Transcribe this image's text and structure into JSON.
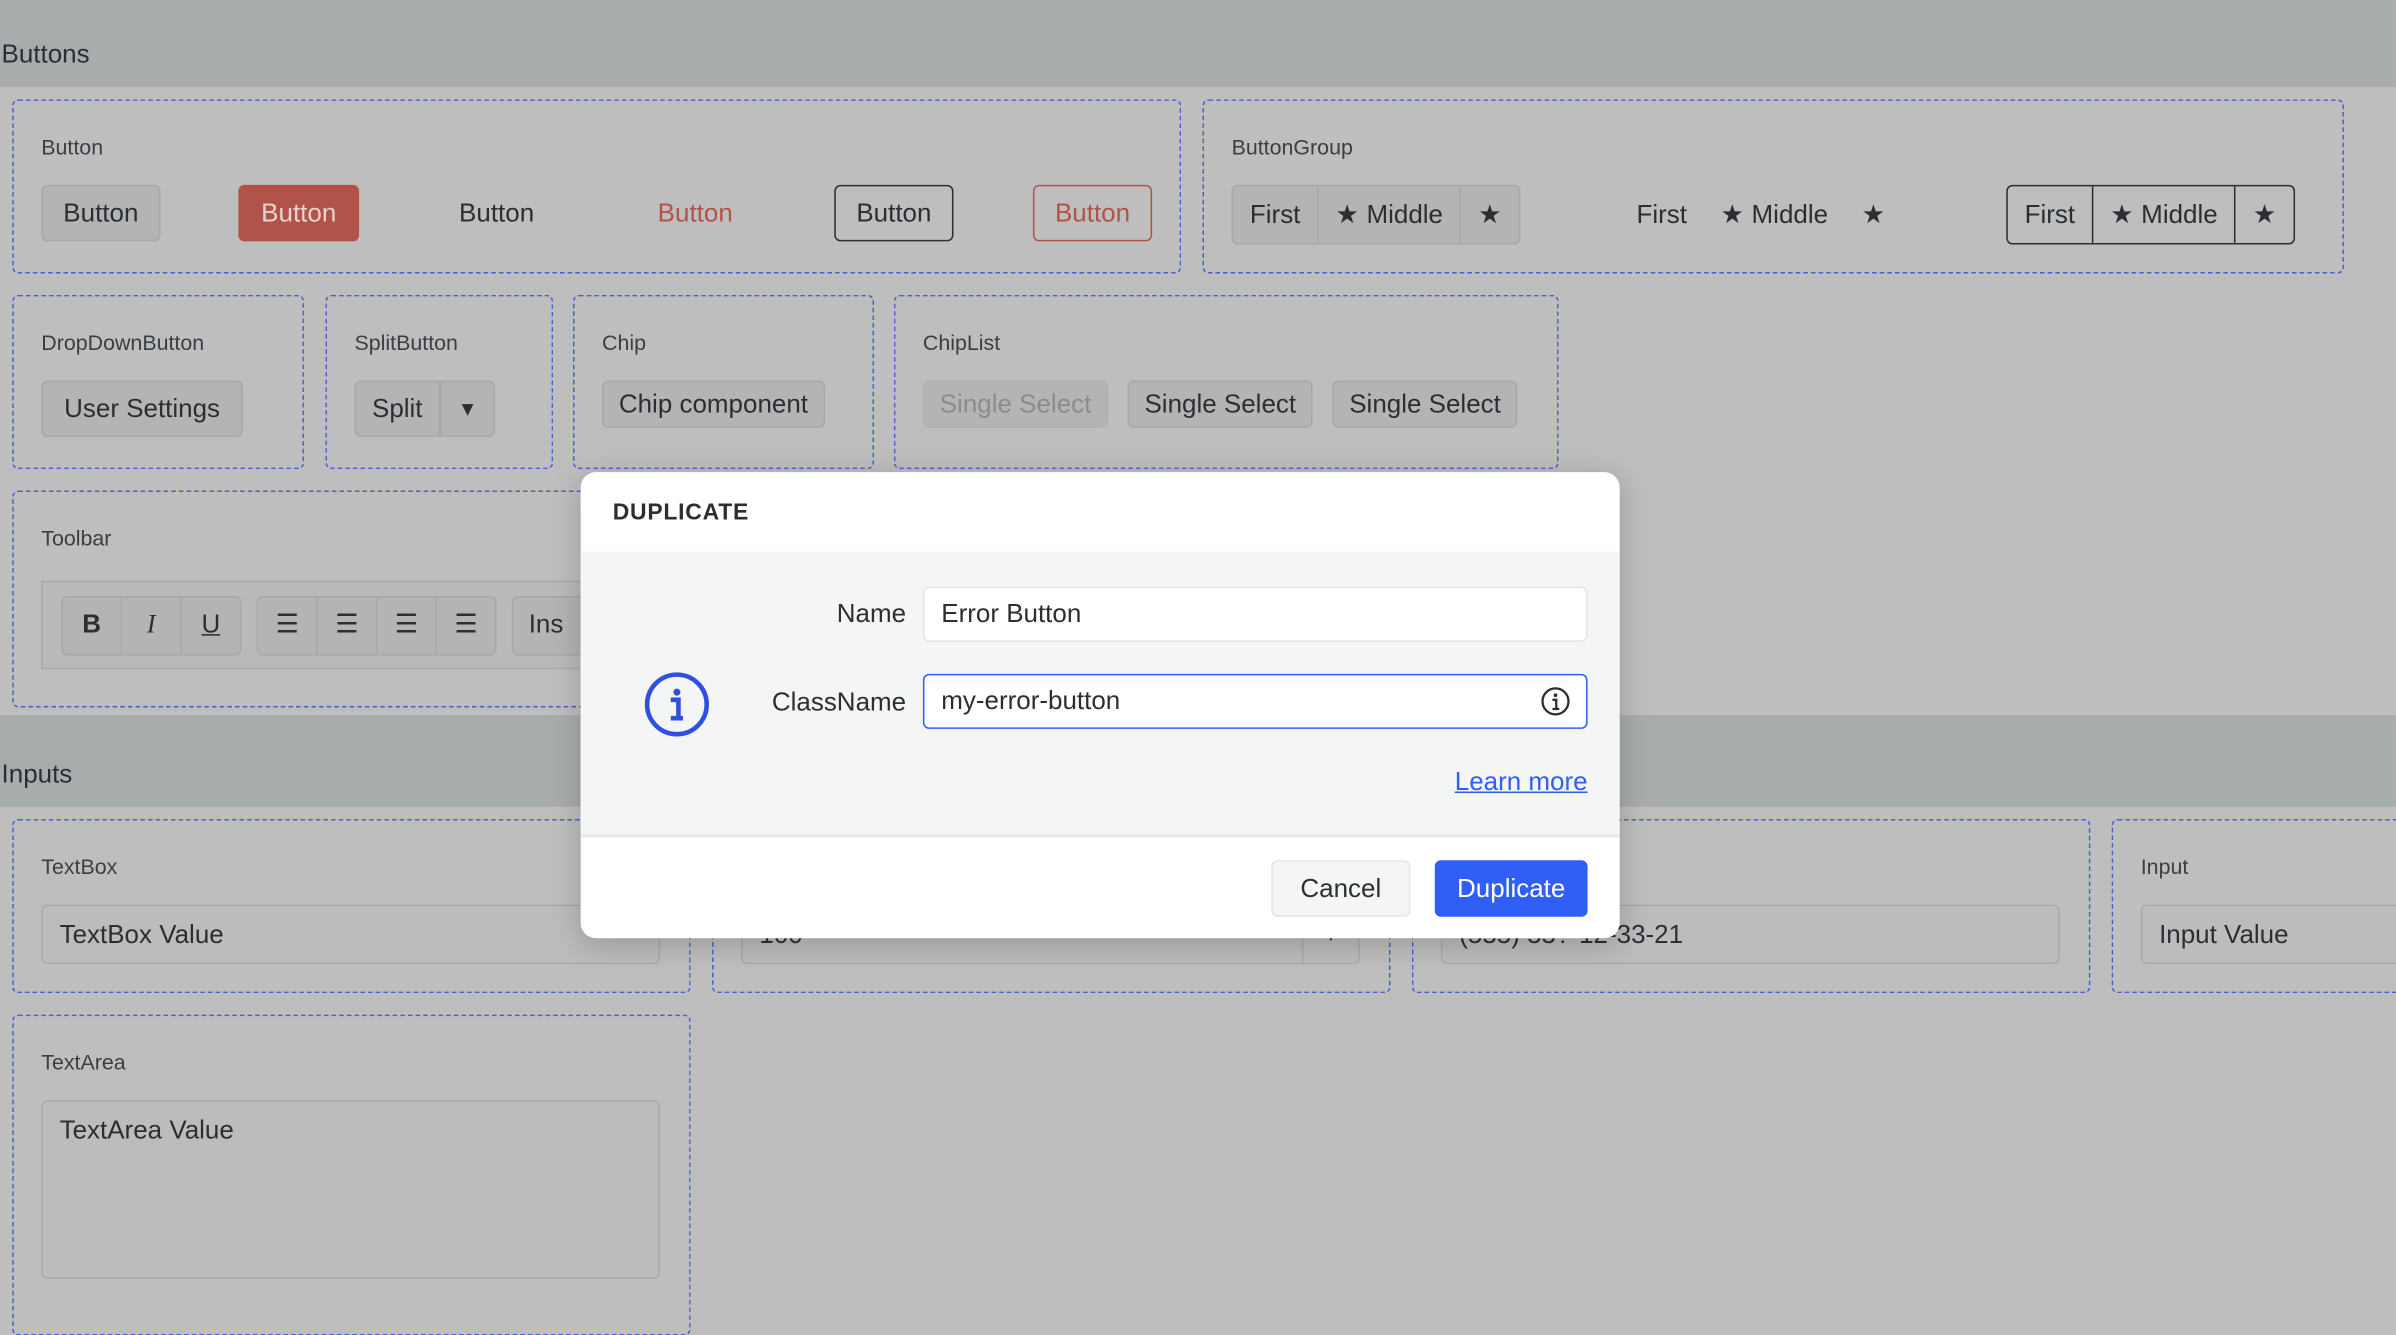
{
  "sections": {
    "buttons": "Buttons",
    "inputs": "Inputs"
  },
  "button_demo": {
    "label": "Button",
    "buttons": [
      "Button",
      "Button",
      "Button",
      "Button",
      "Button",
      "Button"
    ]
  },
  "button_group": {
    "label": "ButtonGroup",
    "items": [
      "First",
      "Middle"
    ]
  },
  "dropdown_button": {
    "label": "DropDownButton",
    "text": "User Settings"
  },
  "split_button": {
    "label": "SplitButton",
    "text": "Split",
    "arrow": "▼"
  },
  "chip": {
    "label": "Chip",
    "text": "Chip component"
  },
  "chip_list": {
    "label": "ChipList",
    "items": [
      "Single Select",
      "Single Select",
      "Single Select"
    ]
  },
  "toolbar": {
    "label": "Toolbar",
    "bold": "B",
    "italic": "I",
    "underline": "U",
    "insert_partial": "Ins"
  },
  "inputs": {
    "textbox": {
      "label": "TextBox",
      "value": "TextBox Value"
    },
    "numeric": {
      "value": "100"
    },
    "masked": {
      "value": "(555) 55?-12-33-21"
    },
    "input": {
      "label": "Input",
      "value": "Input Value"
    },
    "textarea": {
      "label": "TextArea",
      "value": "TextArea Value"
    }
  },
  "dialog": {
    "title": "DUPLICATE",
    "name_label": "Name",
    "name_value": "Error Button",
    "classname_label": "ClassName",
    "classname_value": "my-error-button",
    "learn_more": "Learn more",
    "cancel": "Cancel",
    "duplicate": "Duplicate",
    "accent": "#2f5ff5"
  },
  "colors": {
    "error": "#b25349",
    "dashed_border": "#4a62d0"
  }
}
